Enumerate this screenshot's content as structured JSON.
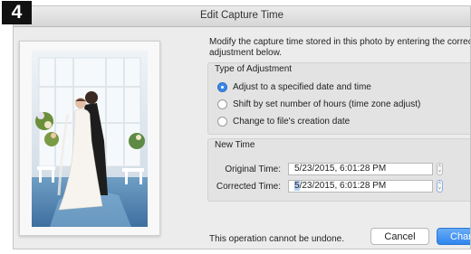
{
  "step_badge": "4",
  "window": {
    "title": "Edit Capture Time"
  },
  "instructions": "Modify the capture time stored in this photo by entering the correct adjustment below.",
  "adjustment": {
    "group_title": "Type of Adjustment",
    "options": [
      {
        "label": "Adjust to a specified date and time",
        "checked": true
      },
      {
        "label": "Shift by set number of hours (time zone adjust)",
        "checked": false
      },
      {
        "label": "Change to file's creation date",
        "checked": false
      }
    ]
  },
  "new_time": {
    "group_title": "New Time",
    "original_label": "Original Time:",
    "original_value": "5/23/2015,  6:01:28 PM",
    "corrected_label": "Corrected Time:",
    "corrected_selected": "5",
    "corrected_rest": "/23/2015,  6:01:28 PM"
  },
  "footer": {
    "warning": "This operation cannot be undone.",
    "cancel_label": "Cancel",
    "change_label": "Change"
  },
  "colors": {
    "accent": "#2f86ee",
    "dialog_bg": "#ececec"
  }
}
